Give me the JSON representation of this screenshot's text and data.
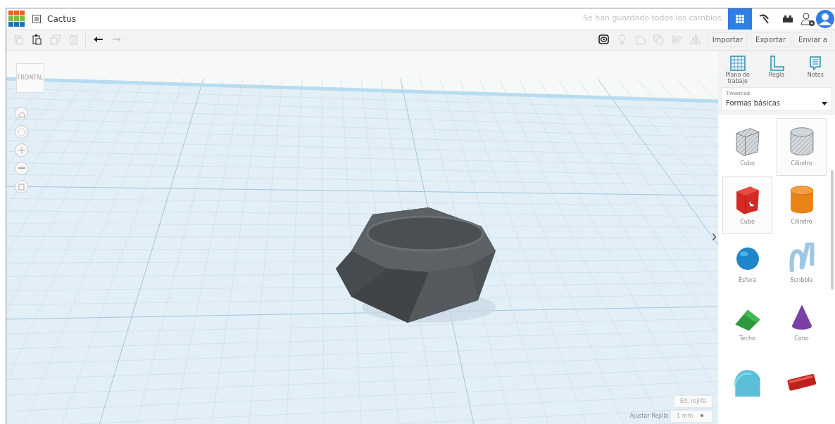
{
  "header": {
    "title": "Cactus",
    "save_status": "Se han guardado todos los cambios.",
    "apps": [
      {
        "kind": "grid",
        "selected": true
      },
      {
        "kind": "pickaxe",
        "selected": false
      },
      {
        "kind": "brick",
        "selected": false
      }
    ]
  },
  "toolbar": {
    "edit_tools": [
      {
        "kind": "copy",
        "disabled": true
      },
      {
        "kind": "paste",
        "disabled": false
      },
      {
        "kind": "duplicate",
        "disabled": true
      },
      {
        "kind": "delete",
        "disabled": true
      },
      {
        "kind": "undo",
        "disabled": false
      },
      {
        "kind": "redo",
        "disabled": true
      }
    ],
    "view_tools": [
      {
        "kind": "show-all",
        "disabled": false
      },
      {
        "kind": "bulb",
        "disabled": true
      },
      {
        "kind": "group",
        "disabled": true
      },
      {
        "kind": "ungroup",
        "disabled": true
      },
      {
        "kind": "align",
        "disabled": true
      },
      {
        "kind": "mirror",
        "disabled": true
      }
    ],
    "actions": [
      "Importar",
      "Exportar",
      "Enviar a"
    ]
  },
  "viewcube": {
    "label": "FRONTAL"
  },
  "nav_controls": [
    {
      "kind": "home"
    },
    {
      "kind": "fit"
    },
    {
      "kind": "zoom-in"
    },
    {
      "kind": "zoom-out"
    },
    {
      "kind": "ortho"
    }
  ],
  "grid_controls": {
    "edit_label": "Ed. rejilla",
    "snap_label": "Ajustar Rejilla",
    "snap_value": "1 mm"
  },
  "panel": {
    "tools": [
      {
        "kind": "workplane",
        "label": "Plano de trabajo"
      },
      {
        "kind": "ruler",
        "label": "Regla"
      },
      {
        "kind": "notes",
        "label": "Notes"
      }
    ],
    "library": {
      "source": "Tinkercad",
      "category": "Formas básicas"
    },
    "shapes": [
      {
        "kind": "box-hole",
        "label": "Cubo",
        "highlighted": false
      },
      {
        "kind": "cylinder-hole",
        "label": "Cilindro",
        "highlighted": true
      },
      {
        "kind": "box",
        "label": "Cubo",
        "highlighted": true
      },
      {
        "kind": "cylinder",
        "label": "Cilindro",
        "highlighted": false
      },
      {
        "kind": "sphere",
        "label": "Esfera",
        "highlighted": false
      },
      {
        "kind": "scribble",
        "label": "Scribble",
        "highlighted": false
      },
      {
        "kind": "roof",
        "label": "Techo",
        "highlighted": false
      },
      {
        "kind": "cone",
        "label": "Cono",
        "highlighted": false
      },
      {
        "kind": "round-roof",
        "highlighted": false
      },
      {
        "kind": "text",
        "highlighted": false
      }
    ]
  }
}
